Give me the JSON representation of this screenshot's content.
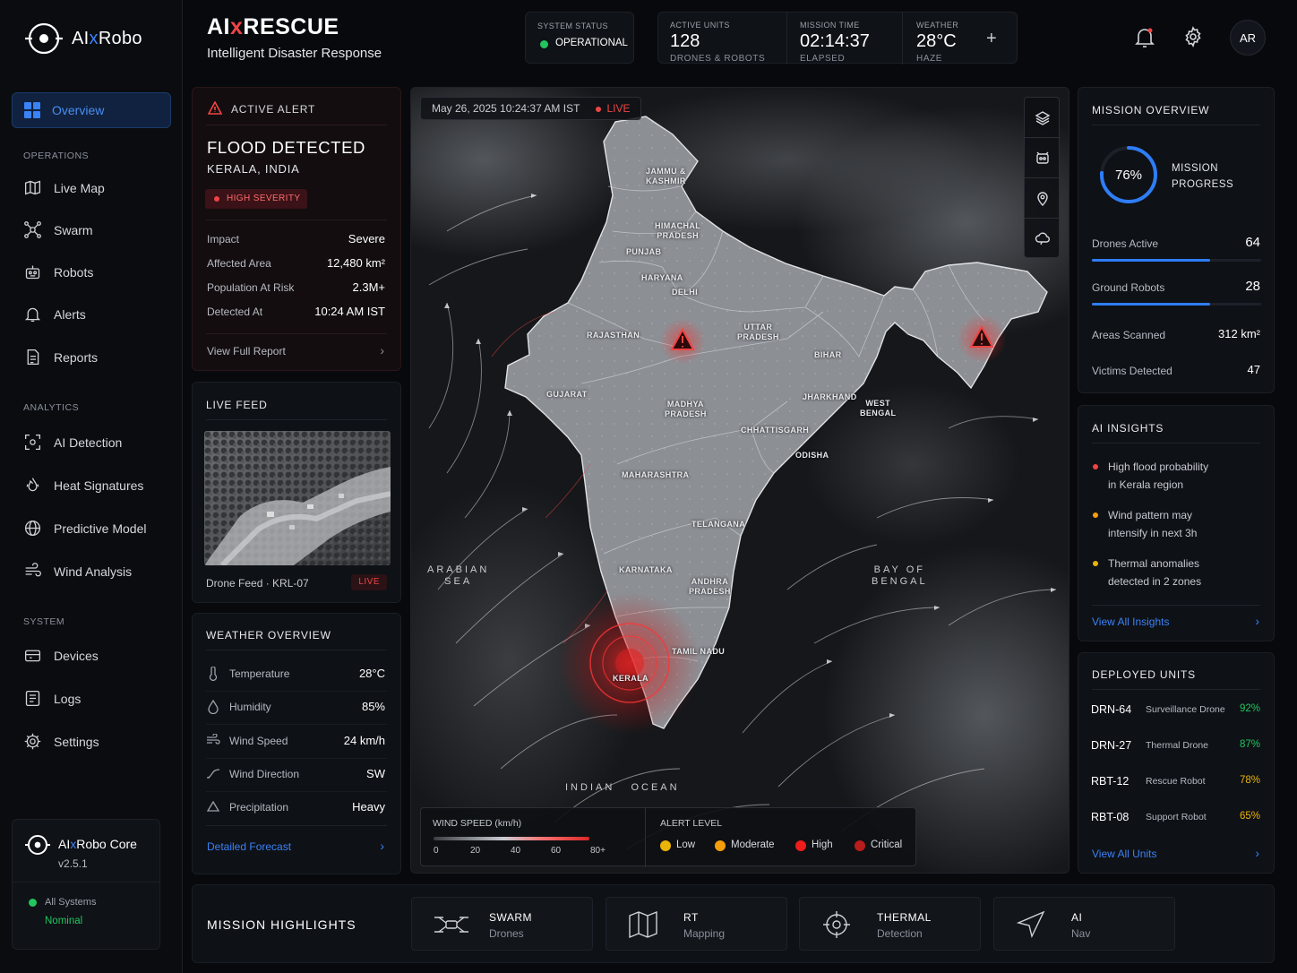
{
  "brand": {
    "name_prefix": "AI",
    "name_x": "x",
    "name_suffix": "Robo"
  },
  "sidebar": {
    "active": "Overview",
    "sections": {
      "operations": "OPERATIONS",
      "analytics": "ANALYTICS",
      "system": "SYSTEM"
    },
    "operations": [
      "Live Map",
      "Swarm",
      "Robots",
      "Alerts",
      "Reports"
    ],
    "analytics": [
      "AI Detection",
      "Heat Signatures",
      "Predictive Model",
      "Wind Analysis"
    ],
    "system": [
      "Devices",
      "Logs",
      "Settings"
    ],
    "core": {
      "title_prefix": "AI",
      "title_x": "x",
      "title_suffix": "Robo Core",
      "version": "v2.5.1",
      "status_line1": "All Systems",
      "status_line2": "Nominal"
    }
  },
  "header": {
    "title_prefix": "AI",
    "title_x": "x",
    "title_suffix": "RESCUE",
    "subtitle": "Intelligent Disaster Response",
    "system_status": {
      "label": "SYSTEM STATUS",
      "value": "OPERATIONAL"
    },
    "active_units": {
      "label": "ACTIVE UNITS",
      "value": "128",
      "sub": "DRONES & ROBOTS"
    },
    "mission_time": {
      "label": "MISSION TIME",
      "value": "02:14:37",
      "sub": "ELAPSED"
    },
    "weather": {
      "label": "WEATHER",
      "value": "28°C",
      "sub": "HAZE"
    },
    "add": "+",
    "avatar": "AR"
  },
  "alert": {
    "heading": "ACTIVE ALERT",
    "title": "FLOOD DETECTED",
    "location": "KERALA, INDIA",
    "severity": "HIGH SEVERITY",
    "rows": [
      {
        "label": "Impact",
        "value": "Severe"
      },
      {
        "label": "Affected Area",
        "value": "12,480 km²"
      },
      {
        "label": "Population At Risk",
        "value": "2.3M+"
      },
      {
        "label": "Detected At",
        "value": "10:24 AM IST"
      }
    ],
    "link": "View Full Report"
  },
  "live_feed": {
    "title": "LIVE FEED",
    "caption": "Drone Feed · KRL-07",
    "badge": "LIVE"
  },
  "weather_overview": {
    "title": "WEATHER OVERVIEW",
    "rows": [
      {
        "label": "Temperature",
        "value": "28°C"
      },
      {
        "label": "Humidity",
        "value": "85%"
      },
      {
        "label": "Wind Speed",
        "value": "24 km/h"
      },
      {
        "label": "Wind Direction",
        "value": "SW"
      },
      {
        "label": "Precipitation",
        "value": "Heavy"
      }
    ],
    "link": "Detailed Forecast"
  },
  "map": {
    "datetime": "May 26, 2025  10:24:37 AM IST",
    "live": "LIVE",
    "states": {
      "jk": "JAMMU &\nKASHMIR",
      "hp": "HIMACHAL\nPRADESH",
      "pb": "PUNJAB",
      "hr": "HARYANA",
      "dl": "DELHI",
      "rj": "RAJASTHAN",
      "up": "UTTAR\nPRADESH",
      "br": "BIHAR",
      "gj": "GUJARAT",
      "mp": "MADHYA\nPRADESH",
      "jh": "JHARKHAND",
      "wb": "WEST\nBENGAL",
      "cg": "CHHATTISGARH",
      "od": "ODISHA",
      "mh": "MAHARASHTRA",
      "tg": "TELANGANA",
      "ka": "KARNATAKA",
      "ap": "ANDHRA\nPRADESH",
      "tn": "TAMIL NADU",
      "kl": "KERALA"
    },
    "seas": {
      "arabian": "ARABIAN\nSEA",
      "bengal": "BAY OF\nBENGAL",
      "indian": "INDIAN   OCEAN"
    },
    "legend": {
      "wind_title": "WIND SPEED (km/h)",
      "wind_ticks": [
        "0",
        "20",
        "40",
        "60",
        "80+"
      ],
      "alert_title": "ALERT LEVEL",
      "alert_levels": [
        {
          "label": "Low",
          "color": "#eab308"
        },
        {
          "label": "Moderate",
          "color": "#f59e0b"
        },
        {
          "label": "High",
          "color": "#ef1c1c"
        },
        {
          "label": "Critical",
          "color": "#b91c1c"
        }
      ]
    }
  },
  "mission_overview": {
    "title": "MISSION OVERVIEW",
    "progress": 76,
    "progress_label": "76%",
    "progress_text": "MISSION\nPROGRESS",
    "rows": [
      {
        "label": "Drones Active",
        "value": "64",
        "bar": 0.7
      },
      {
        "label": "Ground Robots",
        "value": "28",
        "bar": 0.7
      },
      {
        "label": "Areas Scanned",
        "value": "312 km²"
      },
      {
        "label": "Victims Detected",
        "value": "47"
      }
    ]
  },
  "ai_insights": {
    "title": "AI INSIGHTS",
    "items": [
      {
        "text": "High flood probability\nin Kerala region",
        "color": "#ef4444"
      },
      {
        "text": "Wind pattern may\nintensify in next 3h",
        "color": "#f59e0b"
      },
      {
        "text": "Thermal anomalies\ndetected in 2 zones",
        "color": "#eab308"
      }
    ],
    "link": "View All Insights"
  },
  "deployed_units": {
    "title": "DEPLOYED UNITS",
    "units": [
      {
        "id": "DRN-64",
        "type": "Surveillance Drone",
        "pct": "92%",
        "color": "#22c55e"
      },
      {
        "id": "DRN-27",
        "type": "Thermal Drone",
        "pct": "87%",
        "color": "#22c55e"
      },
      {
        "id": "RBT-12",
        "type": "Rescue Robot",
        "pct": "78%",
        "color": "#eab308"
      },
      {
        "id": "RBT-08",
        "type": "Support Robot",
        "pct": "65%",
        "color": "#eab308"
      }
    ],
    "link": "View All Units"
  },
  "highlights": {
    "title": "MISSION HIGHLIGHTS",
    "cards": [
      {
        "title": "SWARM",
        "sub": "Drones",
        "icon": "drone-icon"
      },
      {
        "title": "RT",
        "sub": "Mapping",
        "icon": "map-icon"
      },
      {
        "title": "THERMAL",
        "sub": "Detection",
        "icon": "crosshair-icon"
      },
      {
        "title": "AI",
        "sub": "Nav",
        "icon": "navigation-icon"
      }
    ]
  }
}
